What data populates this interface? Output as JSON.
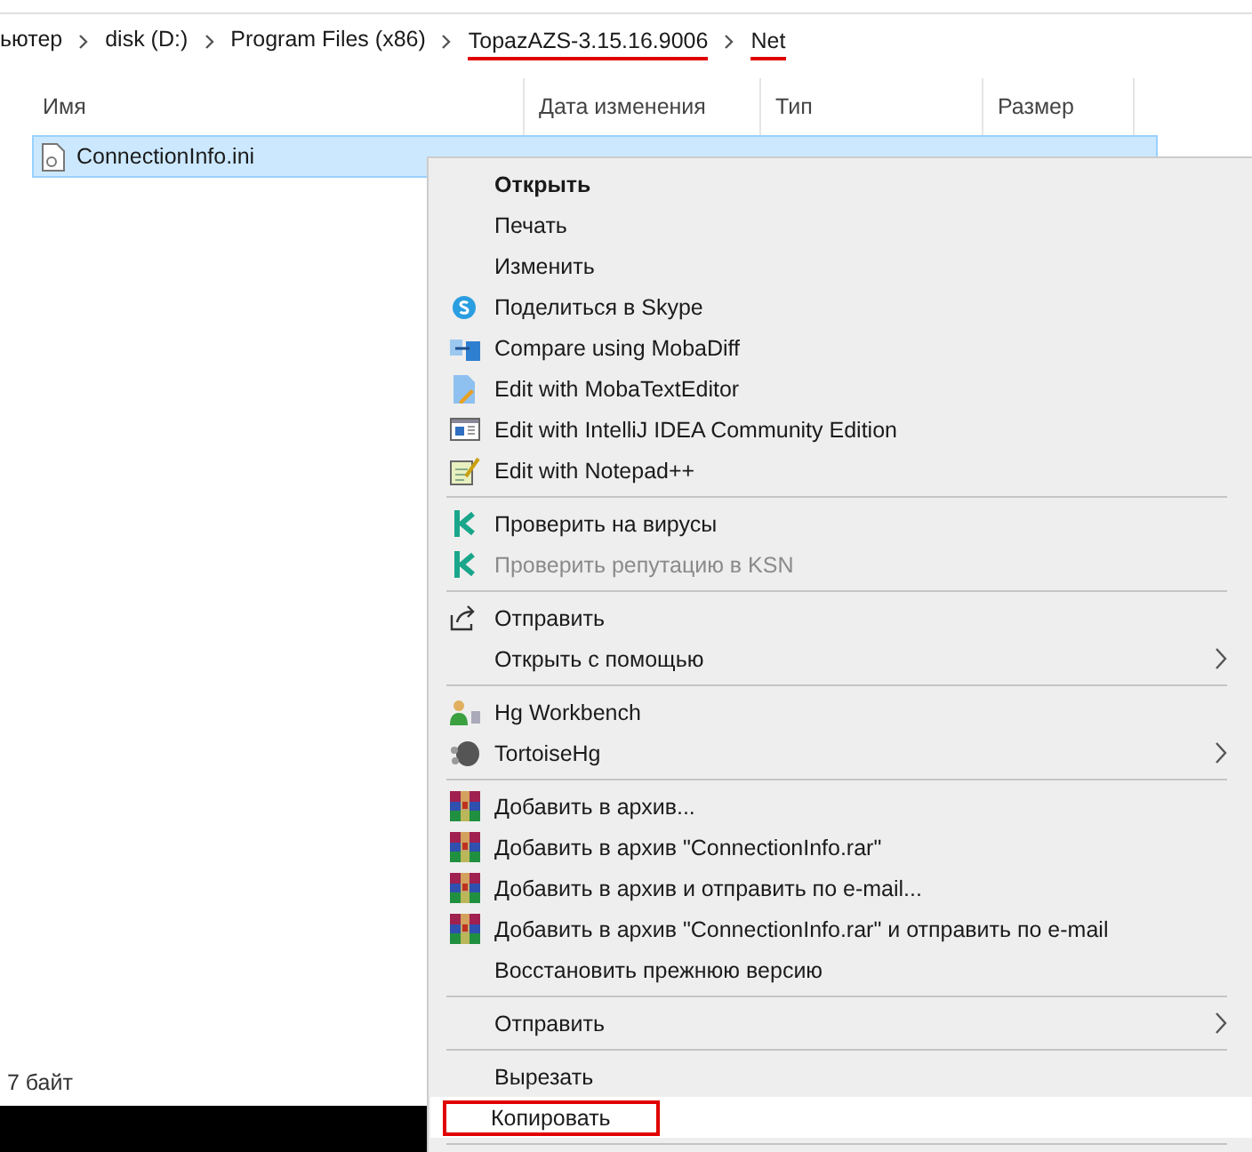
{
  "breadcrumb": [
    {
      "label": "ьютер",
      "highlighted": false
    },
    {
      "label": "disk (D:)",
      "highlighted": false
    },
    {
      "label": "Program Files (x86)",
      "highlighted": false
    },
    {
      "label": "TopazAZS-3.15.16.9006",
      "highlighted": true
    },
    {
      "label": "Net",
      "highlighted": true
    }
  ],
  "columns": [
    "Имя",
    "Дата изменения",
    "Тип",
    "Размер"
  ],
  "files": [
    {
      "name": "ConnectionInfo.ini",
      "selected": true
    }
  ],
  "status_bar": "7 байт",
  "context_menu": [
    {
      "kind": "item",
      "label": "Открыть",
      "default": true
    },
    {
      "kind": "item",
      "label": "Печать"
    },
    {
      "kind": "item",
      "label": "Изменить"
    },
    {
      "kind": "item",
      "label": "Поделиться в Skype"
    },
    {
      "kind": "item",
      "label": "Compare using MobaDiff"
    },
    {
      "kind": "item",
      "label": "Edit with MobaTextEditor"
    },
    {
      "kind": "item",
      "label": "Edit with IntelliJ IDEA Community Edition"
    },
    {
      "kind": "item",
      "label": "Edit with Notepad++"
    },
    {
      "kind": "separator"
    },
    {
      "kind": "item",
      "label": "Проверить на вирусы"
    },
    {
      "kind": "item",
      "label": "Проверить репутацию в KSN",
      "disabled": true
    },
    {
      "kind": "separator"
    },
    {
      "kind": "item",
      "label": "Отправить"
    },
    {
      "kind": "item",
      "label": "Открыть с помощью",
      "submenu": true
    },
    {
      "kind": "separator"
    },
    {
      "kind": "item",
      "label": "Hg Workbench"
    },
    {
      "kind": "item",
      "label": "TortoiseHg",
      "submenu": true
    },
    {
      "kind": "separator"
    },
    {
      "kind": "item",
      "label": "Добавить в архив..."
    },
    {
      "kind": "item",
      "label": "Добавить в архив \"ConnectionInfo.rar\""
    },
    {
      "kind": "item",
      "label": "Добавить в архив и отправить по e-mail..."
    },
    {
      "kind": "item",
      "label": "Добавить в архив \"ConnectionInfo.rar\" и отправить по e-mail"
    },
    {
      "kind": "item",
      "label": "Восстановить прежнюю версию"
    },
    {
      "kind": "separator"
    },
    {
      "kind": "item",
      "label": "Отправить",
      "submenu": true
    },
    {
      "kind": "separator"
    },
    {
      "kind": "item",
      "label": "Вырезать"
    },
    {
      "kind": "item",
      "label": "Копировать",
      "selected": true,
      "highlighted": true
    },
    {
      "kind": "separator"
    }
  ]
}
